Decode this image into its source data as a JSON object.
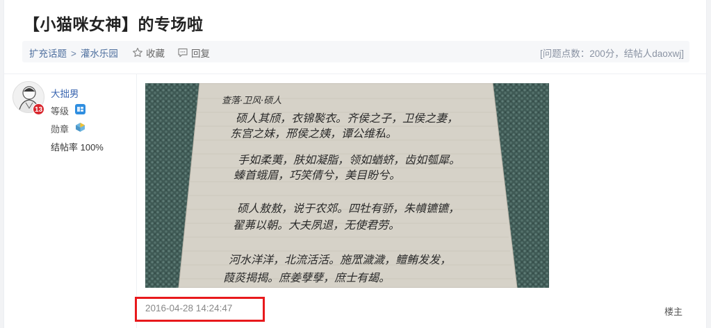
{
  "post": {
    "title": "【小猫咪女神】的专场啦"
  },
  "breadcrumb": {
    "items": [
      "扩充话题",
      "灌水乐园"
    ],
    "separator": ">"
  },
  "actions": {
    "favorite_label": "收藏",
    "reply_label": "回复"
  },
  "topic_info": "[问题点数：200分，结帖人daoxwj]",
  "author": {
    "name": "大拙男",
    "level_badge": "13",
    "level_label": "等级",
    "medal_label": "勋章",
    "close_rate": "结帖率 100%"
  },
  "reply": {
    "timestamp": "2016-04-28 14:24:47",
    "floor_label": "楼主"
  },
  "image": {
    "heading": "查落·卫风·硕人",
    "lines": [
      "硕人其颀，衣锦褧衣。齐侯之子，卫侯之妻，",
      "东宫之妹，邢侯之姨，谭公维私。",
      "手如柔荑，肤如凝脂，领如蝤蛴，齿如瓠犀。",
      "螓首蛾眉，巧笑倩兮，美目盼兮。",
      "硕人敖敖，说于农郊。四牡有骄，朱幩镳镳，",
      "翟茀以朝。大夫夙退，无使君劳。",
      "河水洋洋，北流活活。施罛濊濊，鳣鲔发发，",
      "葭菼揭揭。庶姜孽孽，庶士有朅。"
    ]
  },
  "colors": {
    "link": "#3b66b0",
    "highlight_border": "#e8191c",
    "level_badge": "#d8262d"
  }
}
